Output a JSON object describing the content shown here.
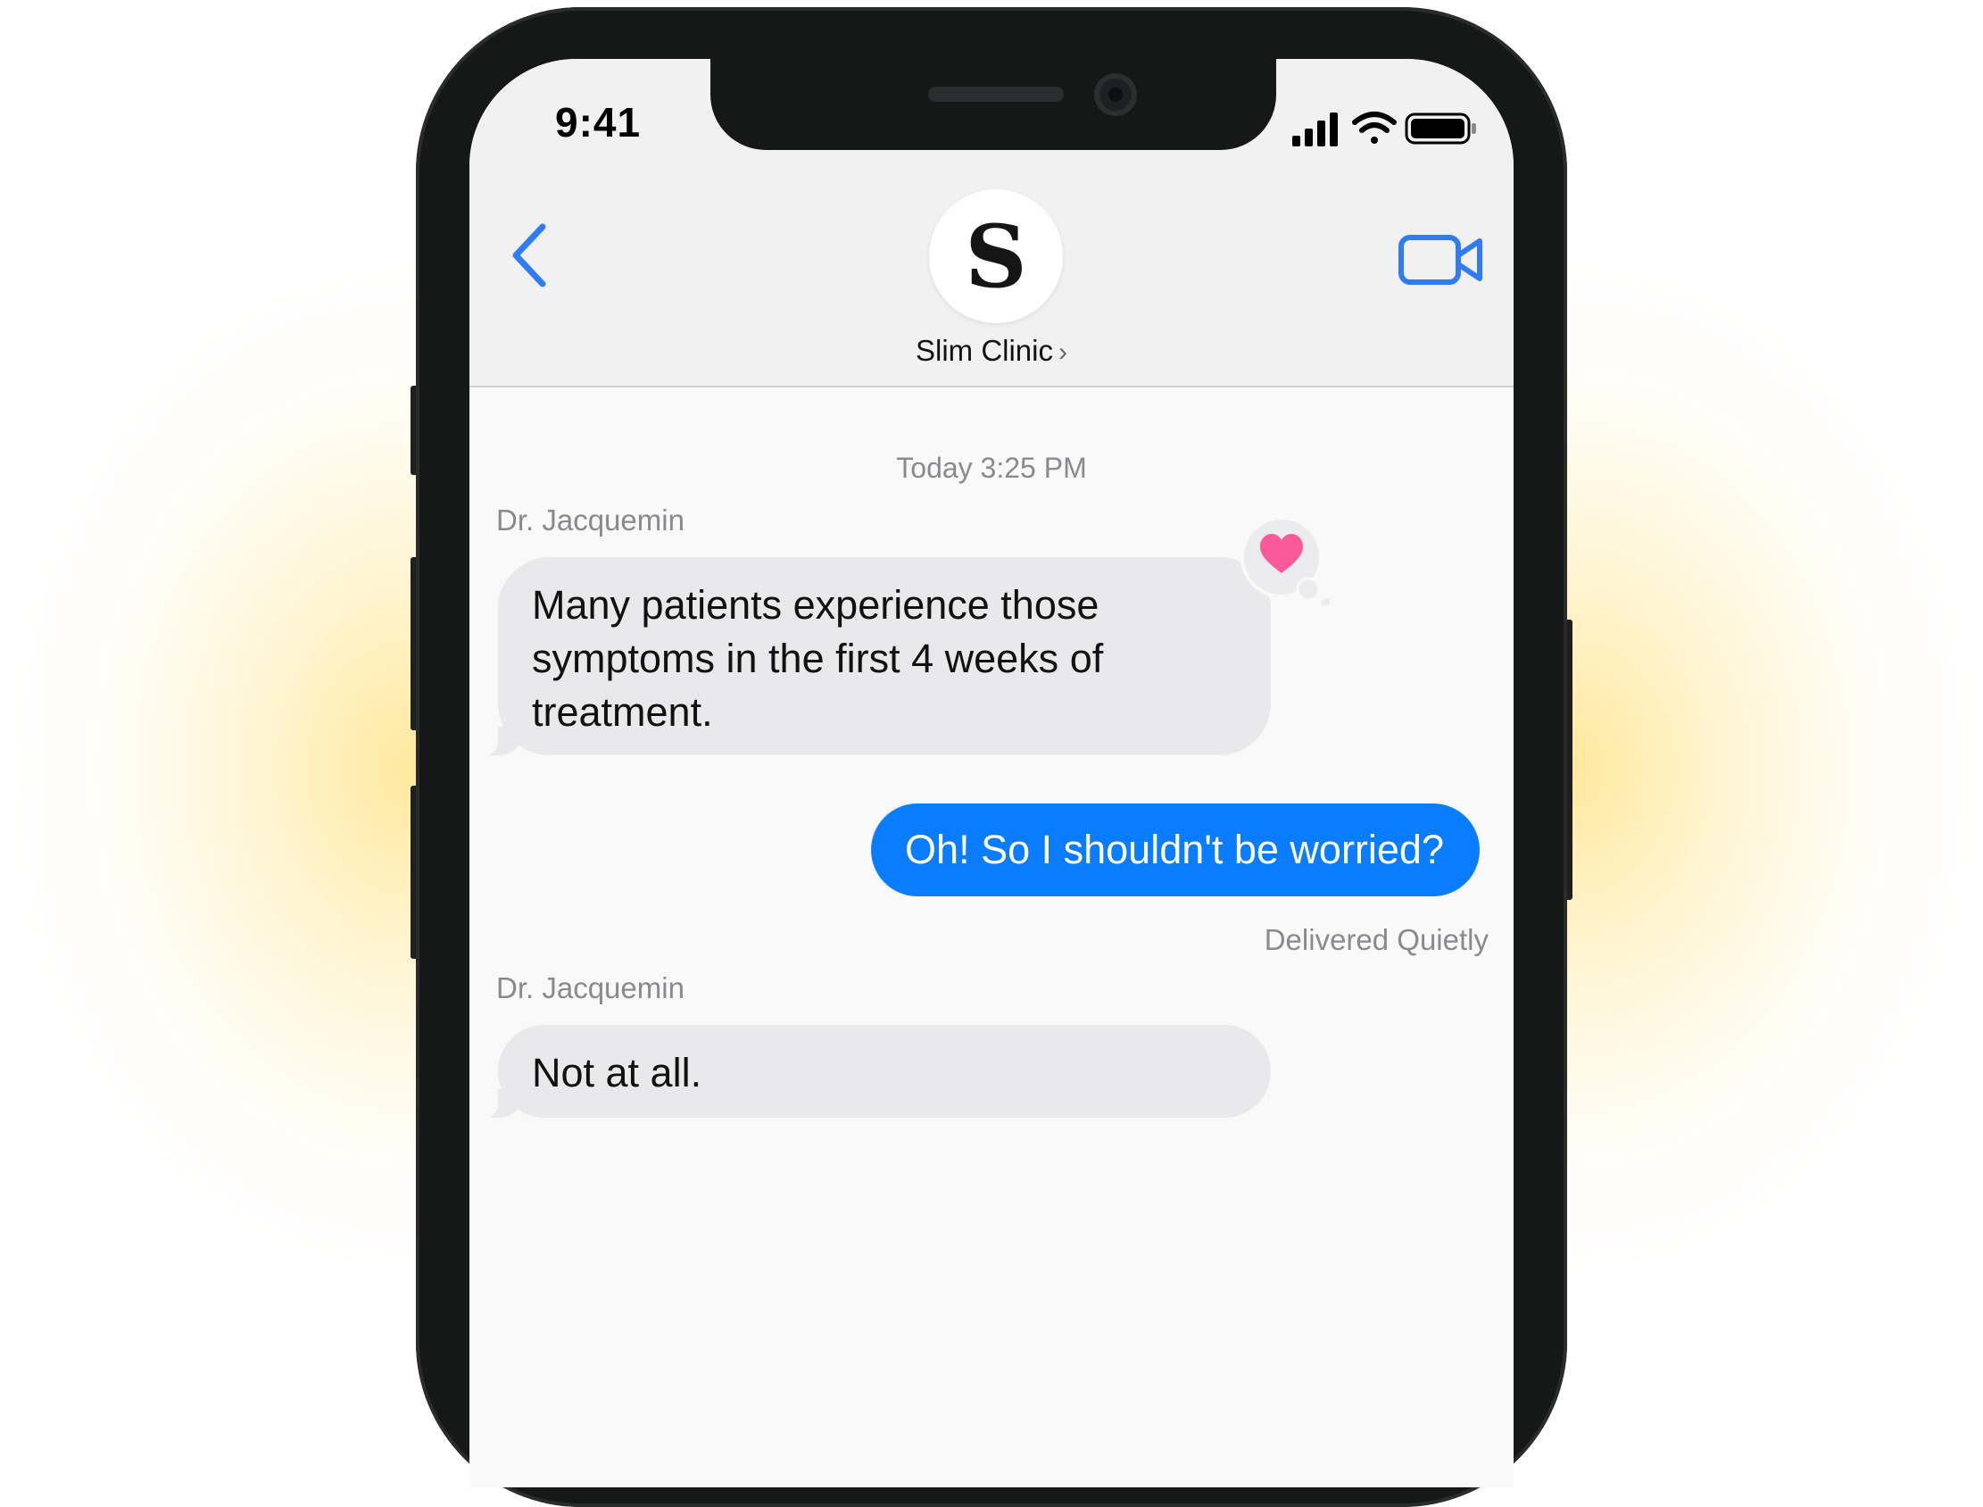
{
  "status_bar": {
    "time": "9:41",
    "icons": [
      "signal-icon",
      "wifi-icon",
      "battery-icon"
    ]
  },
  "header": {
    "back_icon": "chevron-left-icon",
    "avatar_letter": "S",
    "contact_name": "Slim Clinic",
    "contact_chevron": "›",
    "video_icon": "video-camera-icon"
  },
  "conversation": {
    "timestamp": "Today 3:25 PM",
    "messages": [
      {
        "direction": "incoming",
        "sender": "Dr. Jacquemin",
        "text": "Many patients experience those symptoms in the first 4 weeks of treatment.",
        "tapback": "heart-icon"
      },
      {
        "direction": "outgoing",
        "text": "Oh! So I shouldn't be worried?",
        "status": "Delivered Quietly"
      },
      {
        "direction": "incoming",
        "sender": "Dr. Jacquemin",
        "text": "Not at all."
      }
    ]
  },
  "colors": {
    "accent_blue": "#0a7cff",
    "ios_link_blue": "#2f7cf6",
    "incoming_bubble": "#e9e9eb",
    "tapback_heart": "#fa5a9a",
    "glow": "#ffd650"
  }
}
